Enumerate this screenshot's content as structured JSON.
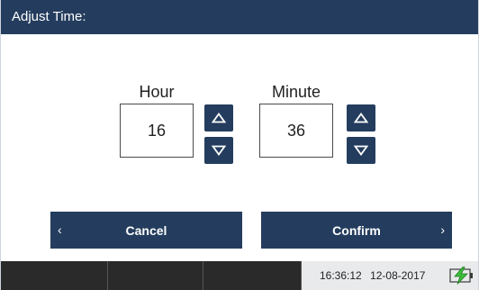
{
  "title": "Adjust Time:",
  "hour": {
    "label": "Hour",
    "value": "16",
    "up_icon": "triangle-up-icon",
    "down_icon": "triangle-down-icon"
  },
  "minute": {
    "label": "Minute",
    "value": "36",
    "up_icon": "triangle-up-icon",
    "down_icon": "triangle-down-icon"
  },
  "actions": {
    "cancel_label": "Cancel",
    "cancel_chevron": "‹",
    "confirm_label": "Confirm",
    "confirm_chevron": "›"
  },
  "status": {
    "clock_time": "16:36:12",
    "clock_date": "12-08-2017",
    "power_icon": "power-charging-icon"
  },
  "colors": {
    "primary": "#243d5e",
    "status_bar": "#2a2a2a",
    "clock_bg": "#e9eaec",
    "power_green": "#3bbf3b"
  }
}
